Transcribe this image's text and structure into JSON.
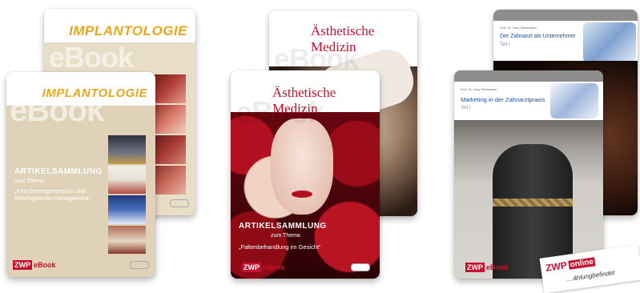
{
  "books": {
    "impl_back": {
      "series": "IMPLANTOLOGIE",
      "watermark": "eBook"
    },
    "impl_front": {
      "series": "IMPLANTOLOGIE",
      "watermark": "eBook",
      "heading": "ARTIKELSAMMLUNG",
      "subheading": "zum Thema",
      "topic": "„Knochenregeneration und Weichgewebs-management“",
      "badge_a": "ZWP",
      "badge_b": "eBook"
    },
    "aes_back": {
      "series": "Ästhetische Medizin",
      "watermark": "eBook"
    },
    "aes_front": {
      "series": "Ästhetische Medizin",
      "watermark": "eBook",
      "heading": "ARTIKELSAMMLUNG",
      "subheading": "zum Thema",
      "topic": "„Faltenbehandlung im Gesicht“",
      "badge_a": "ZWP",
      "badge_b": "eBook"
    },
    "mgmt_back": {
      "author": "Prof. Dr. Gary Steinmeyer",
      "title": "Der Zahnarzt als Unternehmer",
      "part": "Teil I"
    },
    "mgmt_front": {
      "author": "Prof. Dr. Gary Steinmeyer",
      "title": "Marketing in der Zahnarztpraxis",
      "part": "Teil I",
      "badge_a": "ZWP",
      "badge_b": "eBook"
    }
  },
  "stamp": {
    "brand": "ZWP",
    "tag": "online",
    "line": "…ählungbefindet"
  },
  "colors": {
    "orange": "#e8a71c",
    "red": "#c8102e",
    "blue": "#1a4f9c"
  }
}
